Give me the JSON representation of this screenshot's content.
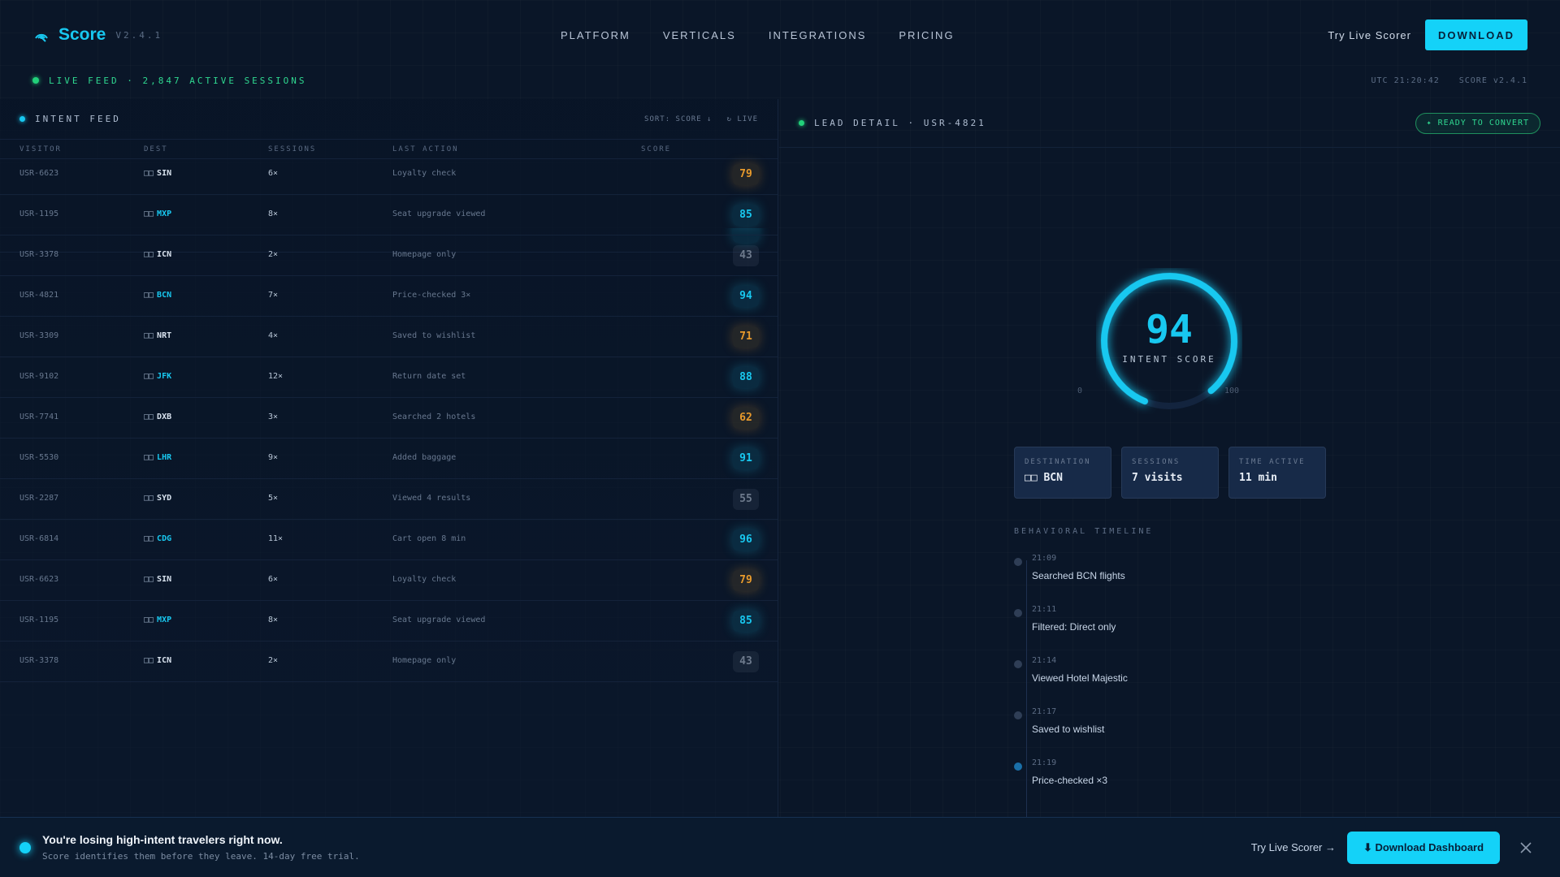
{
  "brand": {
    "name": "Score",
    "version": "V2.4.1"
  },
  "nav": {
    "links": [
      "PLATFORM",
      "VERTICALS",
      "INTEGRATIONS",
      "PRICING"
    ],
    "try_live": "Try Live Scorer",
    "download": "DOWNLOAD"
  },
  "live": {
    "feed_text": "LIVE FEED · 2,847 ACTIVE SESSIONS",
    "utc": "UTC 21:20:42",
    "version": "SCORE v2.4.1"
  },
  "feed": {
    "title": "INTENT FEED",
    "sort": "SORT: SCORE ↓",
    "live": "↻ LIVE",
    "columns": [
      "VISITOR",
      "DEST",
      "SESSIONS",
      "LAST ACTION",
      "SCORE"
    ],
    "rows": [
      {
        "visitor": "USR-6623",
        "flag": "□□",
        "dest": "SIN",
        "sessions": "6×",
        "action": "Loyalty check",
        "score": "79",
        "tone": "amber",
        "hot": false
      },
      {
        "visitor": "USR-1195",
        "flag": "□□",
        "dest": "MXP",
        "sessions": "8×",
        "action": "Seat upgrade viewed",
        "score": "85",
        "tone": "cyan",
        "hot": true
      },
      {
        "visitor": "USR-3378",
        "flag": "□□",
        "dest": "ICN",
        "sessions": "2×",
        "action": "Homepage only",
        "score": "43",
        "tone": "gray",
        "hot": false
      },
      {
        "visitor": "USR-4821",
        "flag": "□□",
        "dest": "BCN",
        "sessions": "7×",
        "action": "Price-checked 3×",
        "score": "94",
        "tone": "cyan",
        "hot": true
      },
      {
        "visitor": "USR-3309",
        "flag": "□□",
        "dest": "NRT",
        "sessions": "4×",
        "action": "Saved to wishlist",
        "score": "71",
        "tone": "amber",
        "hot": false
      },
      {
        "visitor": "USR-9102",
        "flag": "□□",
        "dest": "JFK",
        "sessions": "12×",
        "action": "Return date set",
        "score": "88",
        "tone": "cyan",
        "hot": true
      },
      {
        "visitor": "USR-7741",
        "flag": "□□",
        "dest": "DXB",
        "sessions": "3×",
        "action": "Searched 2 hotels",
        "score": "62",
        "tone": "amber",
        "hot": false
      },
      {
        "visitor": "USR-5530",
        "flag": "□□",
        "dest": "LHR",
        "sessions": "9×",
        "action": "Added baggage",
        "score": "91",
        "tone": "cyan",
        "hot": true
      },
      {
        "visitor": "USR-2287",
        "flag": "□□",
        "dest": "SYD",
        "sessions": "5×",
        "action": "Viewed 4 results",
        "score": "55",
        "tone": "gray",
        "hot": false
      },
      {
        "visitor": "USR-6814",
        "flag": "□□",
        "dest": "CDG",
        "sessions": "11×",
        "action": "Cart open 8 min",
        "score": "96",
        "tone": "cyan",
        "hot": true
      },
      {
        "visitor": "USR-6623",
        "flag": "□□",
        "dest": "SIN",
        "sessions": "6×",
        "action": "Loyalty check",
        "score": "79",
        "tone": "amber",
        "hot": false
      },
      {
        "visitor": "USR-1195",
        "flag": "□□",
        "dest": "MXP",
        "sessions": "8×",
        "action": "Seat upgrade viewed",
        "score": "85",
        "tone": "cyan",
        "hot": true
      },
      {
        "visitor": "USR-3378",
        "flag": "□□",
        "dest": "ICN",
        "sessions": "2×",
        "action": "Homepage only",
        "score": "43",
        "tone": "gray",
        "hot": false
      }
    ]
  },
  "detail": {
    "title": "LEAD DETAIL · USR-4821",
    "badge": "✦ READY TO CONVERT",
    "score": "94",
    "score_fraction": 0.94,
    "score_label": "INTENT SCORE",
    "min": "0",
    "max": "100",
    "stats": [
      {
        "label": "DESTINATION",
        "value": "□□ BCN"
      },
      {
        "label": "SESSIONS",
        "value": "7 visits"
      },
      {
        "label": "TIME ACTIVE",
        "value": "11 min"
      }
    ],
    "timeline_title": "BEHAVIORAL TIMELINE",
    "timeline": [
      {
        "time": "21:09",
        "event": "Searched BCN flights",
        "active": false
      },
      {
        "time": "21:11",
        "event": "Filtered: Direct only",
        "active": false
      },
      {
        "time": "21:14",
        "event": "Viewed Hotel Majestic",
        "active": false
      },
      {
        "time": "21:17",
        "event": "Saved to wishlist",
        "active": false
      },
      {
        "time": "21:19",
        "event": "Price-checked ×3",
        "active": true
      }
    ]
  },
  "banner": {
    "headline": "You're losing high-intent travelers right now.",
    "sub": "Score identifies them before they leave. 14-day free trial.",
    "try": "Try Live Scorer →",
    "button": "⬇ Download Dashboard"
  },
  "colors": {
    "accent": "#14d2f8",
    "green": "#22d07a",
    "amber": "#e89a2c",
    "bg": "#0a1628"
  }
}
